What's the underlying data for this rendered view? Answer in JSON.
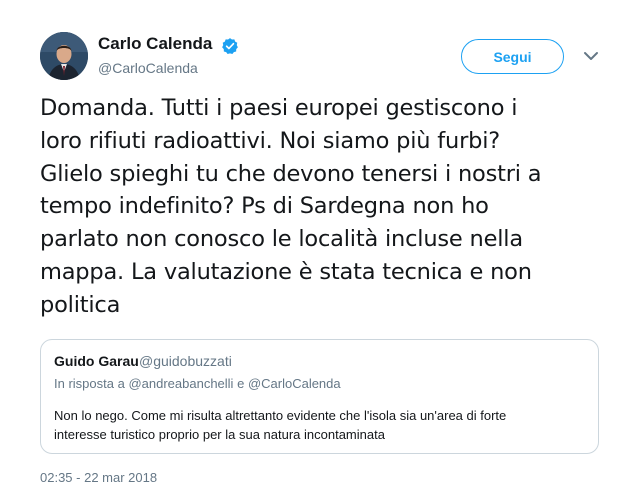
{
  "author": {
    "name": "Carlo Calenda",
    "handle": "@CarloCalenda",
    "verified": true,
    "verified_color": "#1da1f2"
  },
  "actions": {
    "follow_label": "Segui",
    "more_icon": "chevron-down-icon"
  },
  "tweet": {
    "text_lines": [
      "Domanda. Tutti i paesi europei gestiscono i",
      "loro rifiuti radioattivi. Noi siamo più furbi?",
      "Glielo spieghi tu che devono tenersi i nostri a",
      "tempo indefinito? Ps di Sardegna non ho",
      "parlato non conosco le località incluse nella",
      "mappa. La valutazione è stata tecnica e non",
      "politica"
    ],
    "timestamp": "02:35 - 22 mar 2018"
  },
  "quoted_tweet": {
    "name": "Guido Garau",
    "handle": "@guidobuzzati",
    "reply_prefix": "In risposta a",
    "reply_mention_1": "@andreabanchelli",
    "reply_conjunction": "e",
    "reply_mention_2": "@CarloCalenda",
    "text_lines": [
      "Non lo nego. Come mi risulta altrettanto evidente che l'isola sia un'area di forte",
      "interesse turistico proprio per la sua natura incontaminata"
    ]
  },
  "colors": {
    "accent": "#1da1f2",
    "secondary_text": "#657786",
    "border": "#ccd6dd"
  }
}
